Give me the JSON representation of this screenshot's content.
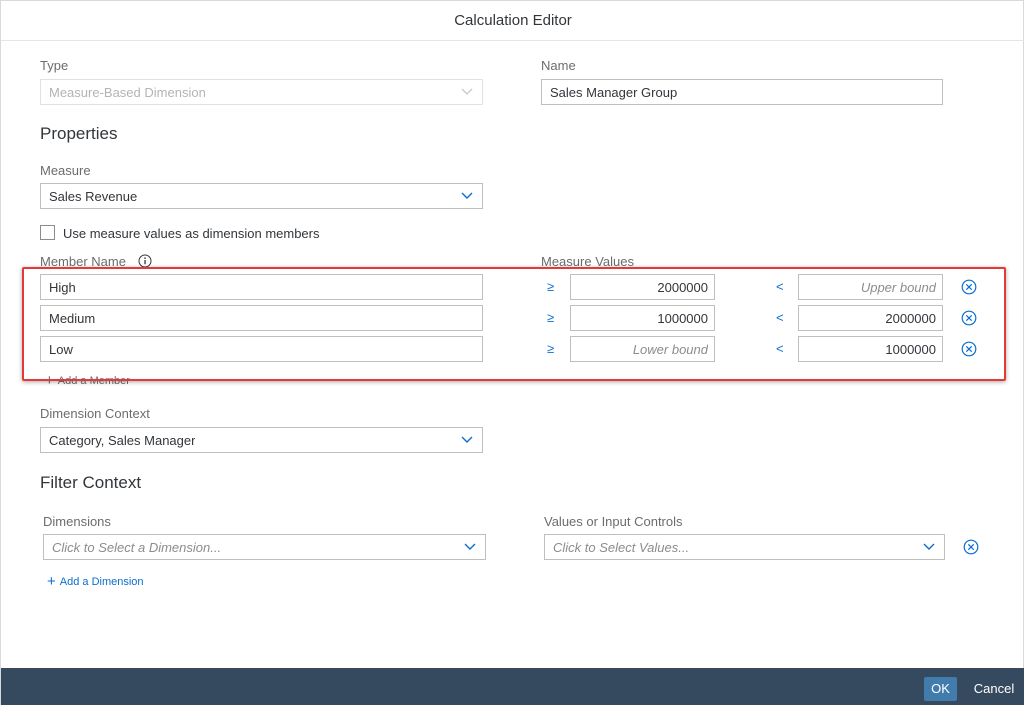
{
  "dialog": {
    "title": "Calculation Editor"
  },
  "type_field": {
    "label": "Type",
    "value": "Measure-Based Dimension"
  },
  "name_field": {
    "label": "Name",
    "value": "Sales Manager Group"
  },
  "properties": {
    "heading": "Properties",
    "measure_label": "Measure",
    "measure_value": "Sales Revenue",
    "checkbox_label": "Use measure values as dimension members",
    "checkbox_checked": false
  },
  "members": {
    "name_header": "Member Name",
    "values_header": "Measure Values",
    "gte_symbol": "≥",
    "lt_symbol": "<",
    "rows": [
      {
        "name": "High",
        "lower": "2000000",
        "upper": "",
        "upper_placeholder": "Upper bound"
      },
      {
        "name": "Medium",
        "lower": "1000000",
        "upper": "2000000"
      },
      {
        "name": "Low",
        "lower": "",
        "lower_placeholder": "Lower bound",
        "upper": "1000000"
      }
    ],
    "add_label": "Add a Member"
  },
  "dimension_context": {
    "label": "Dimension Context",
    "value": "Category, Sales Manager"
  },
  "filter_context": {
    "heading": "Filter Context",
    "dimensions_label": "Dimensions",
    "dimensions_placeholder": "Click to Select a Dimension...",
    "values_label": "Values or Input Controls",
    "values_placeholder": "Click to Select Values...",
    "add_label": "Add a Dimension"
  },
  "footer": {
    "ok_label": "OK",
    "cancel_label": "Cancel"
  },
  "colors": {
    "accent": "#0a6ed1",
    "footer_bg": "#354a5f",
    "ok_bg": "#427cac",
    "highlight": "#e53935"
  }
}
